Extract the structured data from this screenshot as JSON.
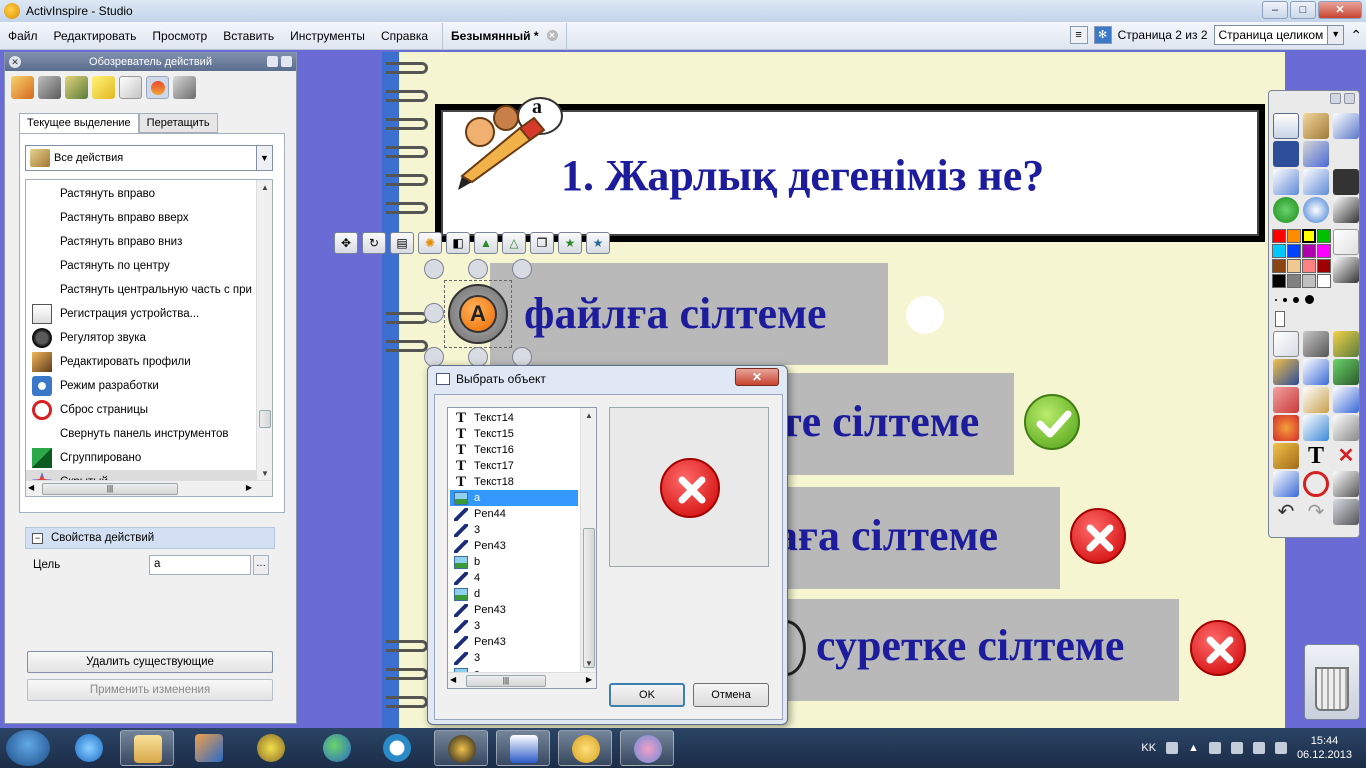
{
  "window": {
    "title": "ActivInspire - Studio",
    "controls": {
      "minimize": "–",
      "maximize": "□",
      "close": "✕"
    }
  },
  "menu": {
    "items": [
      "Файл",
      "Редактировать",
      "Просмотр",
      "Вставить",
      "Инструменты",
      "Справка"
    ],
    "doc_tab": "Безымянный *",
    "page_indicator": "Страница 2 из 2",
    "zoom": "Страница целиком"
  },
  "action_browser": {
    "title": "Обозреватель действий",
    "tabs": [
      "Текущее выделение",
      "Перетащить"
    ],
    "category": "Все действия",
    "actions": [
      {
        "label": "Растянуть вправо",
        "icon": "none"
      },
      {
        "label": "Растянуть вправо вверх",
        "icon": "none"
      },
      {
        "label": "Растянуть вправо вниз",
        "icon": "none"
      },
      {
        "label": "Растянуть по центру",
        "icon": "none"
      },
      {
        "label": "Растянуть центральную часть с при",
        "icon": "none"
      },
      {
        "label": "Регистрация устройства...",
        "icon": "clipboard-icon"
      },
      {
        "label": "Регулятор звука",
        "icon": "speaker-icon"
      },
      {
        "label": "Редактировать профили",
        "icon": "profile-icon"
      },
      {
        "label": "Режим разработки",
        "icon": "gear-icon"
      },
      {
        "label": "Сброс страницы",
        "icon": "reset-icon"
      },
      {
        "label": "Свернуть панель инструментов",
        "icon": "none"
      },
      {
        "label": "Сгруппировано",
        "icon": "group-icon"
      },
      {
        "label": "Скрытый",
        "icon": "hidden-star-icon"
      }
    ],
    "selected_action": "Скрытый",
    "properties_header": "Свойства действий",
    "target_label": "Цель",
    "target_value": "a",
    "delete_button": "Удалить существующие",
    "apply_button": "Применить изменения"
  },
  "flipchart": {
    "question": "1. Жарлық дегеніміз не?",
    "logo_letter": "a",
    "answers": [
      {
        "text": "файлға сілтеме",
        "marker": "A"
      },
      {
        "text": "те сілтеме",
        "result": "correct"
      },
      {
        "text": "аға сілтеме",
        "result": "wrong"
      },
      {
        "text": "суретке сілтеме",
        "result": "wrong"
      }
    ]
  },
  "dialog": {
    "title": "Выбрать объект",
    "objects": [
      {
        "name": "Текст14",
        "type": "text"
      },
      {
        "name": "Текст15",
        "type": "text"
      },
      {
        "name": "Текст16",
        "type": "text"
      },
      {
        "name": "Текст17",
        "type": "text"
      },
      {
        "name": "Текст18",
        "type": "text"
      },
      {
        "name": "a",
        "type": "image"
      },
      {
        "name": "Pen44",
        "type": "pen"
      },
      {
        "name": "3",
        "type": "pen"
      },
      {
        "name": "Pen43",
        "type": "pen"
      },
      {
        "name": "b",
        "type": "image"
      },
      {
        "name": "4",
        "type": "pen"
      },
      {
        "name": "d",
        "type": "image"
      },
      {
        "name": "Pen43",
        "type": "pen"
      },
      {
        "name": "3",
        "type": "pen"
      },
      {
        "name": "Pen43",
        "type": "pen"
      },
      {
        "name": "3",
        "type": "pen"
      },
      {
        "name": "c",
        "type": "image"
      }
    ],
    "selected_object": "a",
    "ok_button": "OK",
    "cancel_button": "Отмена",
    "close": "✕"
  },
  "toolbox": {
    "palette": [
      "#ff0000",
      "#ff8c00",
      "#ffff00",
      "#00c000",
      "#00c8ff",
      "#0040ff",
      "#b000b0",
      "#ff00ff",
      "#8b4513",
      "#f0c890",
      "#ff8080",
      "#a00000",
      "#000000",
      "#808080",
      "#c0c0c0",
      "#ffffff"
    ]
  },
  "taskbar": {
    "apps": [
      "start-button",
      "internet-explorer",
      "file-explorer",
      "media-player",
      "paint-app",
      "messenger",
      "mail-app",
      "browser-app",
      "word-app",
      "activinspire-app",
      "paint-brush-app"
    ],
    "language": "KK",
    "time": "15:44",
    "date": "06.12.2013"
  }
}
